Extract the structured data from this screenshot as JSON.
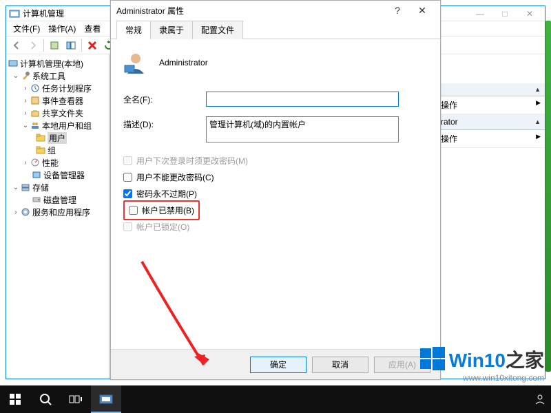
{
  "main_window": {
    "title": "计算机管理",
    "menu": [
      "文件(F)",
      "操作(A)",
      "查看"
    ],
    "tree": {
      "root": "计算机管理(本地)",
      "systools": "系统工具",
      "taskscheduler": "任务计划程序",
      "eventviewer": "事件查看器",
      "sharedfolders": "共享文件夹",
      "localusers": "本地用户和组",
      "users": "用户",
      "groups": "组",
      "performance": "性能",
      "devicemgr": "设备管理器",
      "storage": "存储",
      "diskmgmt": "磁盘管理",
      "services": "服务和应用程序"
    },
    "actions": {
      "more1": "多操作",
      "admin_row": "istrator",
      "more2": "多操作"
    }
  },
  "dialog": {
    "title": "Administrator 属性",
    "tabs": [
      "常规",
      "隶属于",
      "配置文件"
    ],
    "username": "Administrator",
    "fullname_label": "全名(F):",
    "fullname_value": "",
    "description_label": "描述(D):",
    "description_value": "管理计算机(域)的内置帐户",
    "cb_mustchange": "用户下次登录时须更改密码(M)",
    "cb_cannotchange": "用户不能更改密码(C)",
    "cb_neverexpire": "密码永不过期(P)",
    "cb_disabled": "帐户已禁用(B)",
    "cb_locked": "帐户已锁定(O)",
    "btn_ok": "确定",
    "btn_cancel": "取消",
    "btn_apply": "应用(A)"
  },
  "watermark": {
    "brand_prefix": "Win10",
    "brand_suffix": "之家",
    "url": "www.win10xitong.com"
  }
}
